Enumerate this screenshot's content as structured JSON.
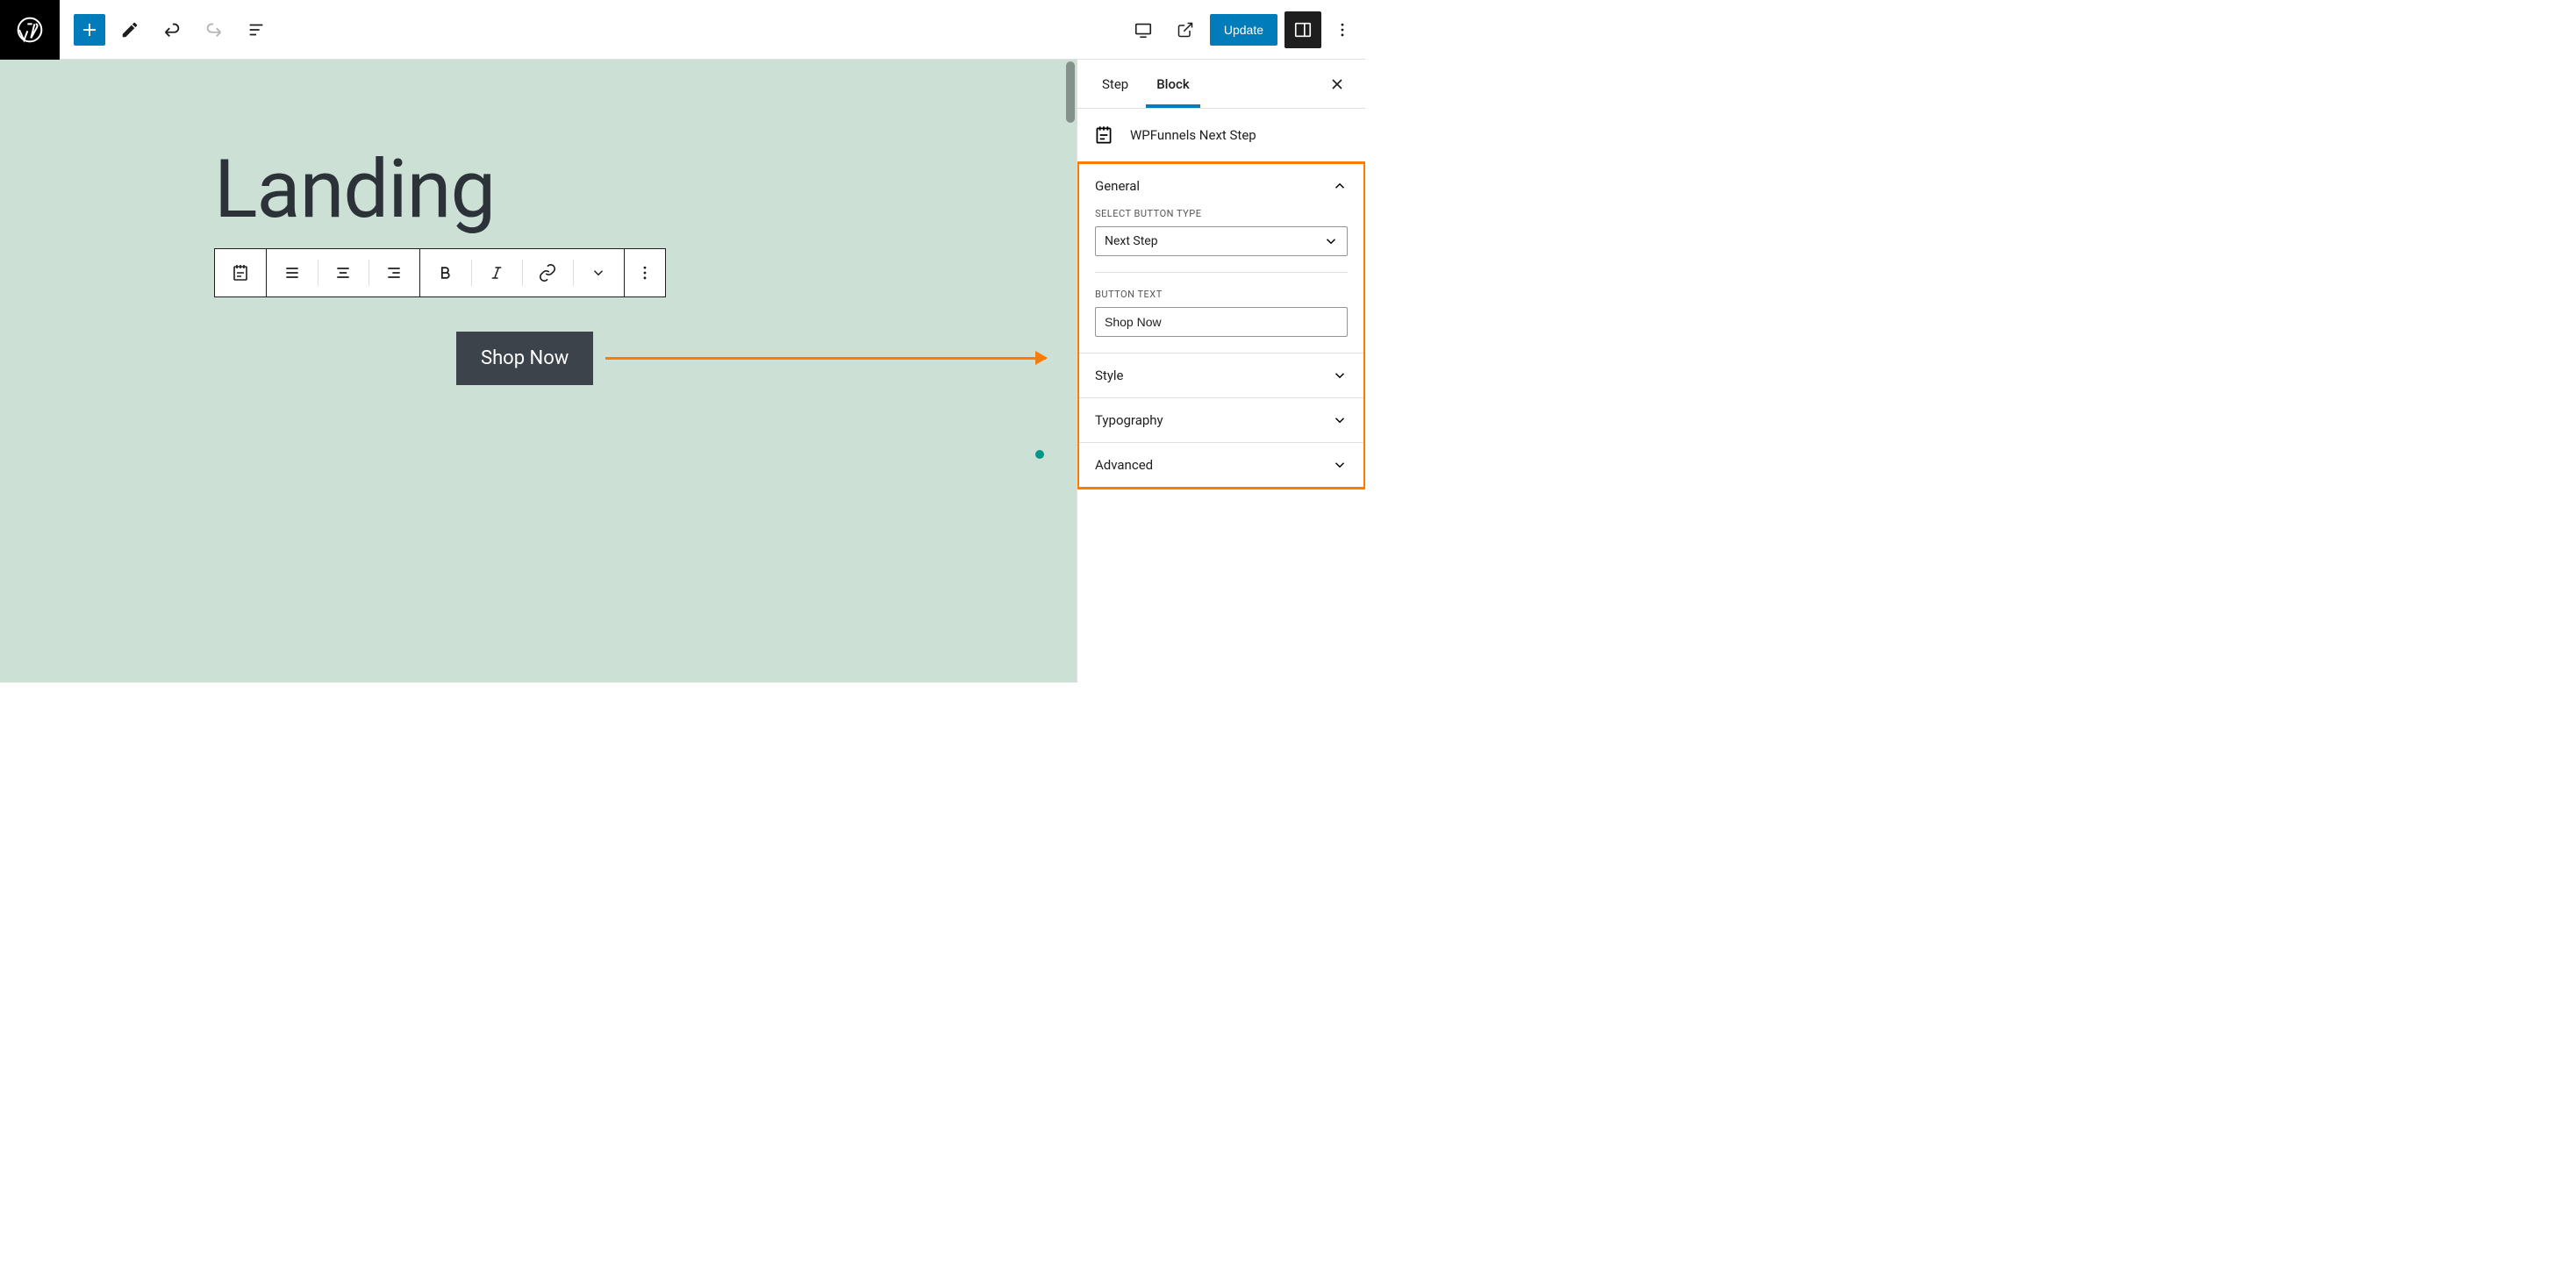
{
  "toolbar": {
    "update_label": "Update"
  },
  "sidebar": {
    "tabs": [
      {
        "label": "Step"
      },
      {
        "label": "Block"
      }
    ],
    "block_name": "WPFunnels Next Step",
    "panels": {
      "general": {
        "title": "General",
        "select_button_type_label": "SELECT BUTTON TYPE",
        "select_value": "Next Step",
        "button_text_label": "BUTTON TEXT",
        "button_text_value": "Shop Now"
      },
      "style": {
        "title": "Style"
      },
      "typography": {
        "title": "Typography"
      },
      "advanced": {
        "title": "Advanced"
      }
    }
  },
  "canvas": {
    "title": "Landing",
    "button_text": "Shop Now"
  }
}
